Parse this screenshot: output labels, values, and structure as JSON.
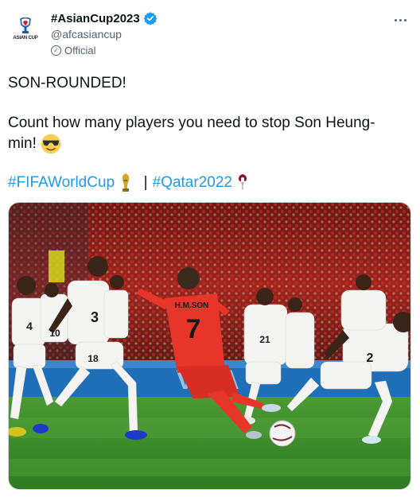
{
  "account": {
    "avatar_text": "ASIAN CUP",
    "display_name": "#AsianCup2023",
    "handle": "@afcasiancup",
    "label": "Official"
  },
  "tweet": {
    "line1": "SON-ROUNDED!",
    "line2a": "Count how many players you need to stop Son Heung-",
    "line2b": "min!",
    "emoji": "sunglasses-face",
    "hashtag1": "#FIFAWorldCup",
    "hashtag2": "#Qatar2022",
    "separator": "|"
  },
  "media": {
    "description": "match-photo",
    "jersey_name": "H.M.SON",
    "jersey_number": "7",
    "opponent_numbers": [
      "4",
      "3",
      "10",
      "18",
      "21",
      "2"
    ]
  },
  "colors": {
    "link": "#1d9bf0",
    "text": "#0f1419",
    "secondary": "#536471",
    "verified": "#1d9bf0",
    "korea_kit": "#e8352a",
    "pitch": "#3f8f2c"
  }
}
